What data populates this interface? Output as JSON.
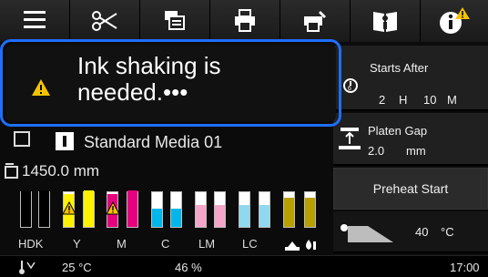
{
  "toolbar": {
    "icons": [
      "menu-icon",
      "cut-icon",
      "copy-job-icon",
      "print-icon",
      "printer-maintenance-icon",
      "book-icon",
      "info-warning-icon"
    ]
  },
  "popup": {
    "message": "Ink shaking is\nneeded.•••",
    "warning_color": "#f5c400",
    "highlight_color": "#1f6fff"
  },
  "media": {
    "name": "Standard Media 01",
    "length": "1450.0  mm"
  },
  "starts_after": {
    "label": "Starts After",
    "hours": "2",
    "h_unit": "H",
    "minutes": "10",
    "m_unit": "M"
  },
  "platen_gap": {
    "label": "Platen Gap",
    "value": "2.0",
    "unit": "mm"
  },
  "preheat": {
    "label": "Preheat Start"
  },
  "temperature": {
    "value": "40",
    "unit": "°C"
  },
  "inks": {
    "labels": [
      "HDK",
      "Y",
      "M",
      "C",
      "LM",
      "LC"
    ],
    "cartridges": [
      {
        "name": "HDK-1",
        "color": "#000000",
        "level": 1.0,
        "warning": false
      },
      {
        "name": "HDK-2",
        "color": "#000000",
        "level": 1.0,
        "warning": false
      },
      {
        "name": "Y-1",
        "color": "#fff200",
        "level": 0.9,
        "warning": true
      },
      {
        "name": "Y-2",
        "color": "#fff200",
        "level": 1.0,
        "warning": false
      },
      {
        "name": "M-1",
        "color": "#e6007e",
        "level": 0.9,
        "warning": true
      },
      {
        "name": "M-2",
        "color": "#e6007e",
        "level": 1.0,
        "warning": false
      },
      {
        "name": "C-1",
        "color": "#00b7eb",
        "level": 0.5,
        "warning": false
      },
      {
        "name": "C-2",
        "color": "#00b7eb",
        "level": 0.5,
        "warning": false
      },
      {
        "name": "LM-1",
        "color": "#f4a6c8",
        "level": 0.6,
        "warning": false
      },
      {
        "name": "LM-2",
        "color": "#f4a6c8",
        "level": 0.6,
        "warning": false
      },
      {
        "name": "LC-1",
        "color": "#8fd8ef",
        "level": 0.6,
        "warning": false
      },
      {
        "name": "LC-2",
        "color": "#8fd8ef",
        "level": 0.6,
        "warning": false
      },
      {
        "name": "maint-1",
        "color": "#b8a000",
        "level": 0.8,
        "warning": false
      },
      {
        "name": "maint-2",
        "color": "#b8a000",
        "level": 0.8,
        "warning": false
      }
    ]
  },
  "status": {
    "room_temp": "25 °C",
    "humidity": "46 %",
    "time": "17:00"
  }
}
